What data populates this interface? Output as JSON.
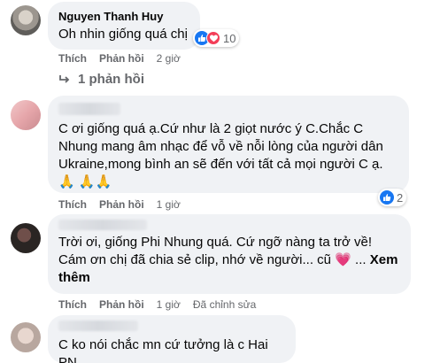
{
  "comments": [
    {
      "author": "Nguyen Thanh Huy",
      "text": "Oh nhin giống quá chị",
      "reaction_count": "10",
      "actions": {
        "like": "Thích",
        "reply": "Phản hồi",
        "time": "2 giờ"
      },
      "replies_link": "1 phản hồi"
    },
    {
      "text": "C ơi giống quá ạ.Cứ như là 2 giọt nước ý C.Chắc C Nhung mang âm nhạc để vỗ về nỗi lòng của người dân Ukraine,mong bình an sẽ đến với tất cả mọi người C ạ.🙏 🙏🙏",
      "reaction_count": "2",
      "actions": {
        "like": "Thích",
        "reply": "Phản hồi",
        "time": "1 giờ"
      }
    },
    {
      "text": "Trời ơi, giống Phi Nhung quá. Cứ ngỡ nàng ta trở về! Cám ơn chị đã chia sẻ clip, nhớ về người... cũ 💗 ...",
      "see_more": "Xem thêm",
      "actions": {
        "like": "Thích",
        "reply": "Phản hồi",
        "time": "1 giờ",
        "edited": "Đã chỉnh sửa"
      }
    },
    {
      "text": "C ko nói chắc mn cứ tưởng là c Hai PN"
    }
  ],
  "colors": {
    "accent": "#1877f2",
    "heart": "#f33e58",
    "bubble": "#f0f2f5",
    "secondary_text": "#65676b"
  },
  "icons": [
    "like-icon",
    "heart-icon",
    "reply-arrow-icon"
  ]
}
